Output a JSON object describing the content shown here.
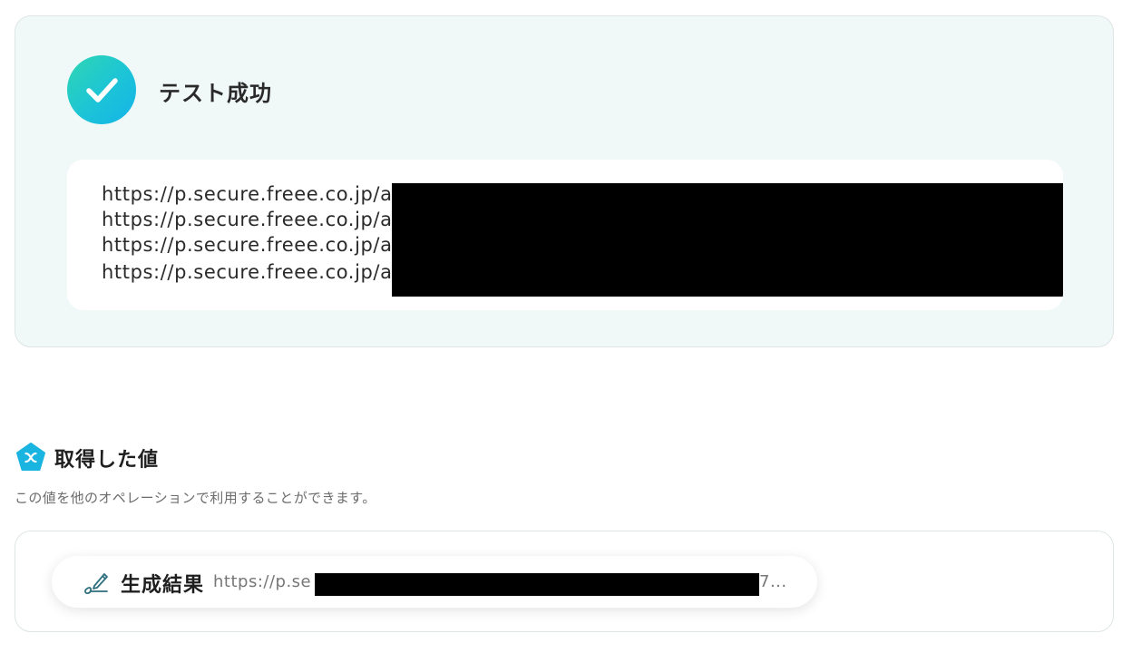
{
  "test_result": {
    "status_label": "テスト成功",
    "urls": [
      "https://p.secure.freee.co.jp/a",
      "https://p.secure.freee.co.jp/a",
      "https://p.secure.freee.co.jp/a",
      "https://p.secure.freee.co.jp/a"
    ]
  },
  "obtained_values": {
    "title": "取得した値",
    "description": "この値を他のオペレーションで利用することができます。",
    "items": [
      {
        "label": "生成結果",
        "value_prefix": "https://p.se",
        "value_suffix": "7..."
      }
    ]
  },
  "colors": {
    "success_gradient_start": "#2fd6b2",
    "success_gradient_end": "#15b3e8",
    "card_background": "#f1f9f8",
    "section_icon": "#1ab4e0"
  },
  "icons": {
    "status": "check-circle-icon",
    "section": "pentagon-x-icon",
    "item": "pen-icon"
  }
}
